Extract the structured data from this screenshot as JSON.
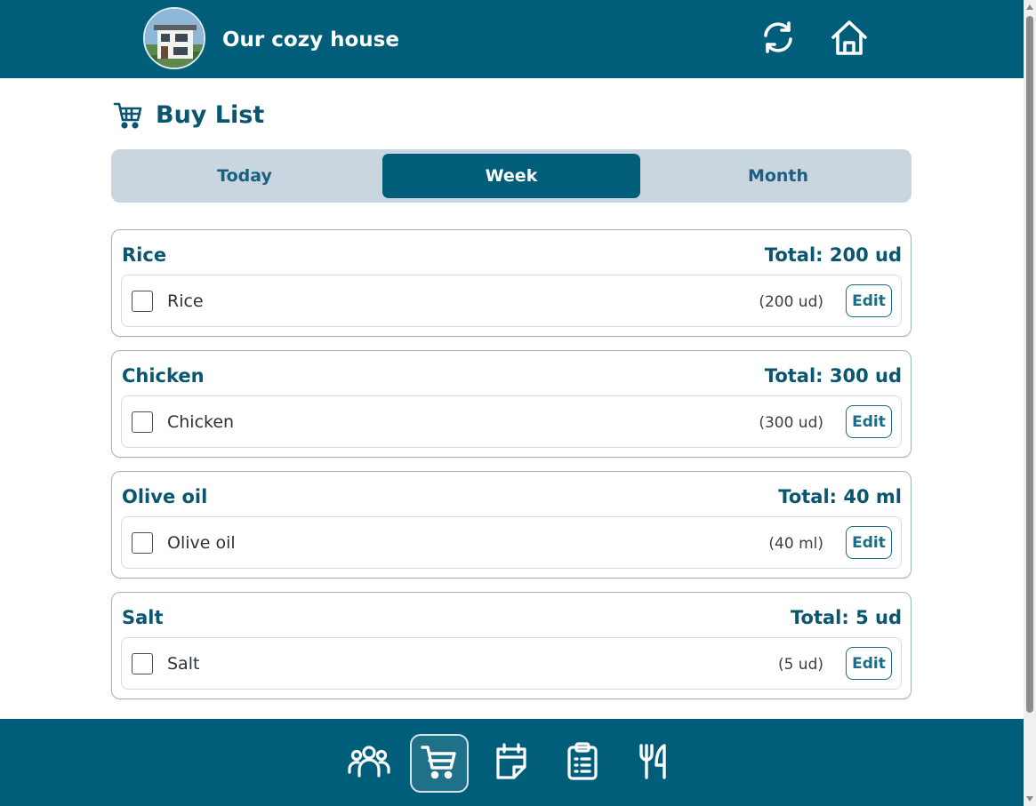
{
  "header": {
    "app_title": "Our cozy house",
    "avatar_icon": "house-photo-avatar",
    "refresh_icon": "refresh-icon",
    "home_icon": "home-icon"
  },
  "page": {
    "title": "Buy List",
    "title_icon": "cart-icon"
  },
  "tabs": [
    {
      "label": "Today",
      "active": false
    },
    {
      "label": "Week",
      "active": true
    },
    {
      "label": "Month",
      "active": false
    }
  ],
  "groups": [
    {
      "title": "Rice",
      "total": "Total: 200 ud",
      "items": [
        {
          "name": "Rice",
          "qty": "(200 ud)",
          "edit_label": "Edit",
          "checked": false
        }
      ]
    },
    {
      "title": "Chicken",
      "total": "Total: 300 ud",
      "items": [
        {
          "name": "Chicken",
          "qty": "(300 ud)",
          "edit_label": "Edit",
          "checked": false
        }
      ]
    },
    {
      "title": "Olive oil",
      "total": "Total: 40 ml",
      "items": [
        {
          "name": "Olive oil",
          "qty": "(40 ml)",
          "edit_label": "Edit",
          "checked": false
        }
      ]
    },
    {
      "title": "Salt",
      "total": "Total: 5 ud",
      "items": [
        {
          "name": "Salt",
          "qty": "(5 ud)",
          "edit_label": "Edit",
          "checked": false
        }
      ]
    }
  ],
  "bottom_nav": [
    {
      "icon": "people-icon",
      "active": false
    },
    {
      "icon": "cart-icon",
      "active": true
    },
    {
      "icon": "calendar-icon",
      "active": false
    },
    {
      "icon": "clipboard-list-icon",
      "active": false
    },
    {
      "icon": "fork-knife-icon",
      "active": false
    }
  ],
  "colors": {
    "primary": "#005e7a",
    "tabs_background": "#c9d5df",
    "heading_text": "#0a5570"
  }
}
